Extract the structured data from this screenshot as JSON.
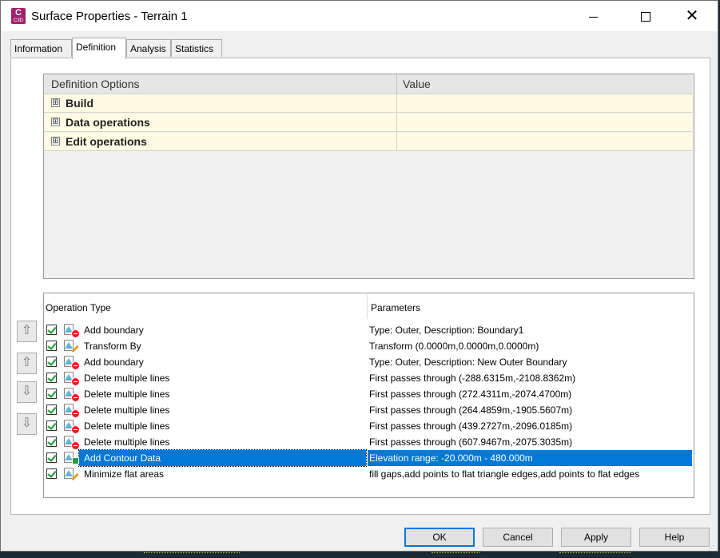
{
  "window": {
    "title": "Surface Properties - Terrain 1",
    "app_icon": {
      "letter": "C",
      "sub": "C3D",
      "color": "#a0226b"
    },
    "controls": {
      "minimize": "minimize-icon",
      "maximize": "maximize-icon",
      "close": "close-icon"
    }
  },
  "tabs": [
    {
      "label": "Information",
      "active": false
    },
    {
      "label": "Definition",
      "active": true
    },
    {
      "label": "Analysis",
      "active": false
    },
    {
      "label": "Statistics",
      "active": false
    }
  ],
  "definition_grid": {
    "headers": [
      "Definition Options",
      "Value"
    ],
    "rows": [
      {
        "label": "Build",
        "expander": "⊞",
        "value": ""
      },
      {
        "label": "Data operations",
        "expander": "⊞",
        "value": ""
      },
      {
        "label": "Edit operations",
        "expander": "⊞",
        "value": ""
      }
    ],
    "row_color": "#fdfbe4"
  },
  "side_buttons": [
    {
      "name": "move-to-top-icon",
      "glyph": "⇧"
    },
    {
      "name": "move-up-icon",
      "glyph": "⇧"
    },
    {
      "name": "move-down-icon",
      "glyph": "⇩"
    },
    {
      "name": "move-to-bottom-icon",
      "glyph": "⇩"
    }
  ],
  "operations": {
    "headers": [
      "Operation Type",
      "Parameters"
    ],
    "rows": [
      {
        "type": "Add boundary",
        "params": "Type: Outer,  Description: Boundary1",
        "checked": true,
        "icon": "boundary-icon",
        "badge": "red"
      },
      {
        "type": "Transform By",
        "params": "Transform (0.0000m,0.0000m,0.0000m)",
        "checked": true,
        "icon": "transform-icon",
        "badge": "pencil"
      },
      {
        "type": "Add boundary",
        "params": "Type: Outer,  Description: New Outer Boundary",
        "checked": true,
        "icon": "boundary-icon",
        "badge": "red"
      },
      {
        "type": "Delete multiple lines",
        "params": "First passes through (-288.6315m,-2108.8362m)",
        "checked": true,
        "icon": "delete-lines-icon",
        "badge": "red"
      },
      {
        "type": "Delete multiple lines",
        "params": "First passes through (272.4311m,-2074.4700m)",
        "checked": true,
        "icon": "delete-lines-icon",
        "badge": "red"
      },
      {
        "type": "Delete multiple lines",
        "params": "First passes through (264.4859m,-1905.5607m)",
        "checked": true,
        "icon": "delete-lines-icon",
        "badge": "red"
      },
      {
        "type": "Delete multiple lines",
        "params": "First passes through (439.2727m,-2096.0185m)",
        "checked": true,
        "icon": "delete-lines-icon",
        "badge": "red"
      },
      {
        "type": "Delete multiple lines",
        "params": "First passes through (607.9467m,-2075.3035m)",
        "checked": true,
        "icon": "delete-lines-icon",
        "badge": "red"
      },
      {
        "type": "Add Contour Data",
        "params": "Elevation range: -20.000m - 480.000m",
        "checked": true,
        "icon": "contour-data-icon",
        "badge": "green",
        "selected": true
      },
      {
        "type": "Minimize flat areas",
        "params": "fill gaps,add points to flat triangle edges,add points to flat edges",
        "checked": true,
        "icon": "flat-areas-icon",
        "badge": "pencil"
      }
    ],
    "selection_color": "#0078d7"
  },
  "buttons": {
    "ok": "OK",
    "cancel": "Cancel",
    "apply": "Apply",
    "help": "Help"
  }
}
